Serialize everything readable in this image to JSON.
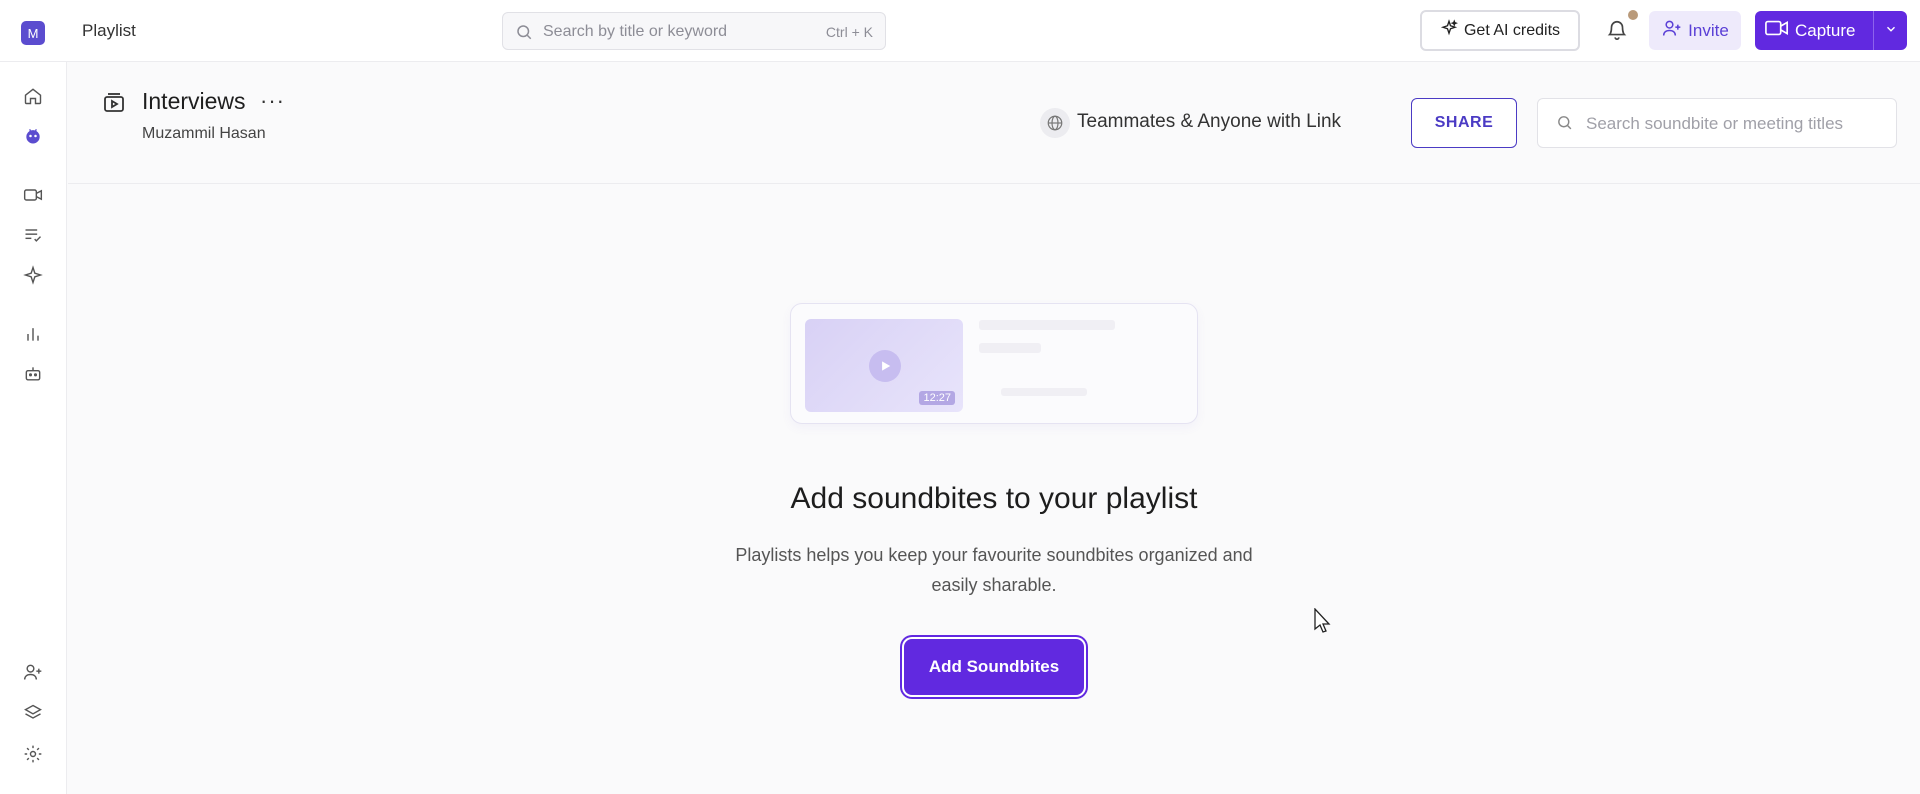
{
  "topbar": {
    "avatar_initial": "M",
    "page_label": "Playlist",
    "search_placeholder": "Search by title or keyword",
    "search_shortcut": "Ctrl + K",
    "ai_credits_label": "Get AI credits",
    "invite_label": "Invite",
    "capture_label": "Capture"
  },
  "sidebar": {
    "items": [
      {
        "icon": "home-icon"
      },
      {
        "icon": "bot-avatar-icon"
      },
      {
        "icon": "video-icon"
      },
      {
        "icon": "list-check-icon"
      },
      {
        "icon": "sparkle-icon"
      },
      {
        "icon": "bar-chart-icon"
      },
      {
        "icon": "robot-icon"
      },
      {
        "icon": "add-user-icon"
      },
      {
        "icon": "layers-icon"
      },
      {
        "icon": "settings-icon"
      }
    ]
  },
  "playlist": {
    "title": "Interviews",
    "more": "···",
    "owner": "Muzammil Hasan",
    "access_label": "Teammates & Anyone with Link",
    "share_label": "SHARE",
    "search_placeholder": "Search soundbite or meeting titles"
  },
  "empty_state": {
    "thumb_duration": "12:27",
    "title": "Add soundbites to your playlist",
    "description": "Playlists helps you keep your favourite soundbites organized and easily sharable.",
    "add_button_label": "Add Soundbites"
  },
  "colors": {
    "accent": "#6129e0",
    "accent_outline": "#4b3bc4",
    "invite_bg": "#eeeafb"
  }
}
